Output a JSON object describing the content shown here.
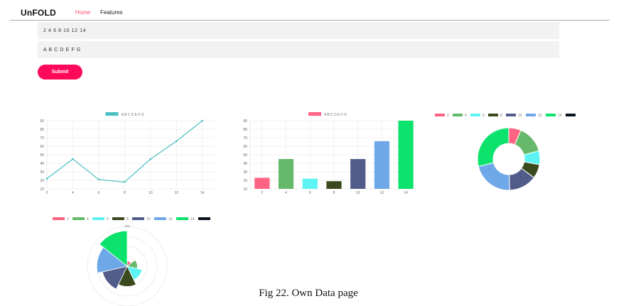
{
  "header": {
    "brand": "UnFOLD",
    "nav": [
      "Home",
      "Features"
    ]
  },
  "form": {
    "data_input": "2 4 6 8 10 12 14",
    "labels_input": "A B C D E F G",
    "submit_label": "Submit"
  },
  "colors": {
    "accent": "#ff0a5a",
    "nav_active": "#ff4f6d",
    "line": "#4bc0c0",
    "palette": [
      "#ff6384",
      "#66b96a",
      "#5ef3f3",
      "#3a4a1e",
      "#525c8a",
      "#6ea8e8",
      "#0ce36c",
      "#0a1420"
    ]
  },
  "chart_data": [
    {
      "type": "line",
      "legend": [
        "A B C D E F G"
      ],
      "x": [
        2,
        4,
        6,
        8,
        10,
        12,
        14
      ],
      "ylim": [
        10,
        90
      ],
      "yticks": [
        10,
        20,
        30,
        40,
        50,
        60,
        70,
        80,
        90
      ],
      "series": [
        {
          "name": "A B C D E F G",
          "values": [
            22,
            45,
            21,
            18,
            45,
            66,
            90
          ]
        }
      ],
      "grid": true
    },
    {
      "type": "bar",
      "legend": [
        "A B C D E F G"
      ],
      "categories": [
        2,
        4,
        6,
        8,
        10,
        12,
        14
      ],
      "ylim": [
        10,
        90
      ],
      "yticks": [
        10,
        20,
        30,
        40,
        50,
        60,
        70,
        80,
        90
      ],
      "series": [
        {
          "name": "A B C D E F G",
          "values": [
            23,
            45,
            22,
            19,
            45,
            66,
            90
          ]
        }
      ],
      "grid": true
    },
    {
      "type": "pie",
      "variant": "doughnut",
      "legend": [
        "2",
        "4",
        "6",
        "8",
        "10",
        "12",
        "14"
      ],
      "values": [
        7,
        16,
        8,
        8,
        16,
        24,
        32
      ]
    },
    {
      "type": "pie",
      "variant": "polar-area",
      "legend": [
        "2",
        "4",
        "6",
        "8",
        "10",
        "12",
        "14"
      ],
      "values": [
        2,
        4,
        6,
        8,
        10,
        12,
        14
      ],
      "tick_label": "100"
    }
  ],
  "caption": "Fig 22. Own Data page"
}
